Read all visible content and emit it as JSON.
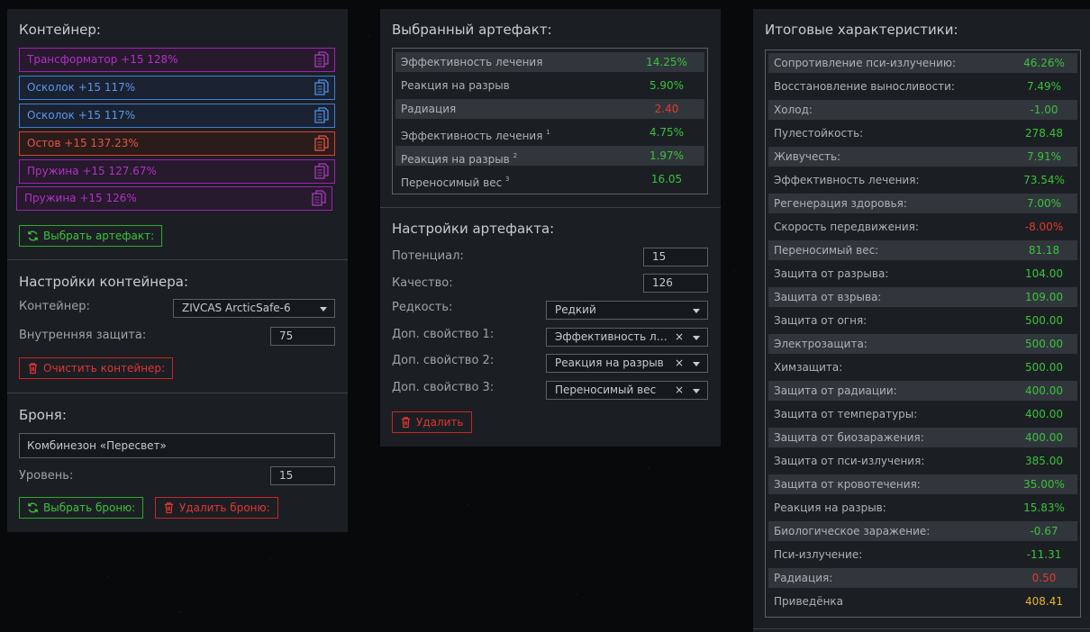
{
  "container_panel": {
    "title": "Контейнер:",
    "artifacts": [
      {
        "label": "Трансформатор +15 128%",
        "color": "purple"
      },
      {
        "label": "Осколок +15 117%",
        "color": "blue"
      },
      {
        "label": "Осколок +15 117%",
        "color": "blue"
      },
      {
        "label": "Остов +15 137.23%",
        "color": "red"
      },
      {
        "label": "Пружина +15 127.67%",
        "color": "purple"
      },
      {
        "label": "Пружина +15 126%",
        "color": "purple"
      }
    ],
    "select_artifact_button": "Выбрать артефакт:",
    "settings_title": "Настройки контейнера:",
    "container_label": "Контейнер:",
    "container_value": "ZIVCAS ArcticSafe-6",
    "internal_protection_label": "Внутренняя защита:",
    "internal_protection_value": "75",
    "clear_button": "Очистить контейнер:",
    "armor_title": "Броня:",
    "armor_value": "Комбинезон «Пересвет»",
    "level_label": "Уровень:",
    "level_value": "15",
    "select_armor_button": "Выбрать броню:",
    "delete_armor_button": "Удалить броню:"
  },
  "artifact_panel": {
    "title": "Выбранный артефакт:",
    "stats": [
      {
        "name": "Эффективность лечения",
        "sup": "",
        "value": "14.25%",
        "color": "green"
      },
      {
        "name": "Реакция на разрыв",
        "sup": "",
        "value": "5.90%",
        "color": "green"
      },
      {
        "name": "Радиация",
        "sup": "",
        "value": "2.40",
        "color": "red"
      },
      {
        "name": "Эффективность лечения",
        "sup": "1",
        "value": "4.75%",
        "color": "green"
      },
      {
        "name": "Реакция на разрыв",
        "sup": "2",
        "value": "1.97%",
        "color": "green"
      },
      {
        "name": "Переносимый вес",
        "sup": "3",
        "value": "16.05",
        "color": "green"
      }
    ],
    "settings_title": "Настройки артефакта:",
    "potential_label": "Потенциал:",
    "potential_value": "15",
    "quality_label": "Качество:",
    "quality_value": "126",
    "rarity_label": "Редкость:",
    "rarity_value": "Редкий",
    "extra1_label": "Доп. свойство 1:",
    "extra1_value": "Эффективность ле...",
    "extra2_label": "Доп. свойство 2:",
    "extra2_value": "Реакция на разрыв",
    "extra3_label": "Доп. свойство 3:",
    "extra3_value": "Переносимый вес",
    "delete_button": "Удалить"
  },
  "totals_panel": {
    "title": "Итоговые характеристики:",
    "stats": [
      {
        "name": "Сопротивление пси-излучению:",
        "value": "46.26%",
        "color": "green"
      },
      {
        "name": "Восстановление выносливости:",
        "value": "7.49%",
        "color": "green"
      },
      {
        "name": "Холод:",
        "value": "-1.00",
        "color": "green"
      },
      {
        "name": "Пулестойкость:",
        "value": "278.48",
        "color": "green"
      },
      {
        "name": "Живучесть:",
        "value": "7.91%",
        "color": "green"
      },
      {
        "name": "Эффективность лечения:",
        "value": "73.54%",
        "color": "green"
      },
      {
        "name": "Регенерация здоровья:",
        "value": "7.00%",
        "color": "green"
      },
      {
        "name": "Скорость передвижения:",
        "value": "-8.00%",
        "color": "red"
      },
      {
        "name": "Переносимый вес:",
        "value": "81.18",
        "color": "green"
      },
      {
        "name": "Защита от разрыва:",
        "value": "104.00",
        "color": "green"
      },
      {
        "name": "Защита от взрыва:",
        "value": "109.00",
        "color": "green"
      },
      {
        "name": "Защита от огня:",
        "value": "500.00",
        "color": "green"
      },
      {
        "name": "Электрозащита:",
        "value": "500.00",
        "color": "green"
      },
      {
        "name": "Химзащита:",
        "value": "500.00",
        "color": "green"
      },
      {
        "name": "Защита от радиации:",
        "value": "400.00",
        "color": "green"
      },
      {
        "name": "Защита от температуры:",
        "value": "400.00",
        "color": "green"
      },
      {
        "name": "Защита от биозаражения:",
        "value": "400.00",
        "color": "green"
      },
      {
        "name": "Защита от пси-излучения:",
        "value": "385.00",
        "color": "green"
      },
      {
        "name": "Защита от кровотечения:",
        "value": "35.00%",
        "color": "green"
      },
      {
        "name": "Реакция на разрыв:",
        "value": "15.83%",
        "color": "green"
      },
      {
        "name": "Биологическое заражение:",
        "value": "-0.67",
        "color": "green"
      },
      {
        "name": "Пси-излучение:",
        "value": "-11.31",
        "color": "green"
      },
      {
        "name": "Радиация:",
        "value": "0.50",
        "color": "red"
      },
      {
        "name": "Приведёнка",
        "value": "408.41",
        "color": "gold"
      }
    ]
  }
}
